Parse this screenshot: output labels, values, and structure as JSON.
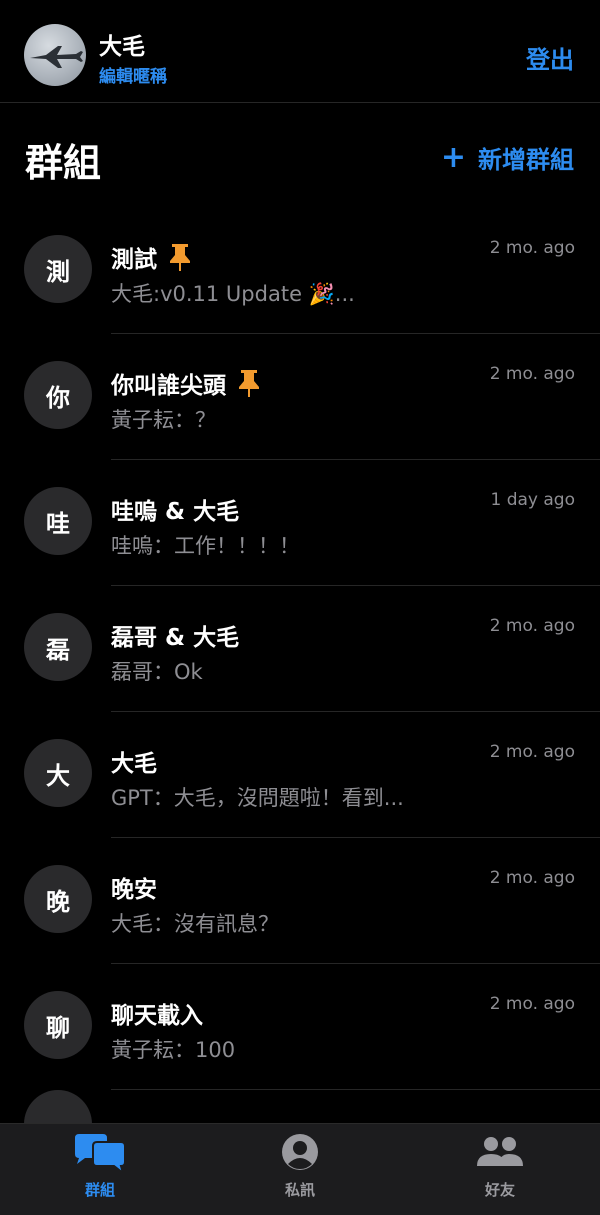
{
  "profile": {
    "name": "大毛",
    "edit_label": "編輯暱稱",
    "logout_label": "登出"
  },
  "section": {
    "title": "群組",
    "add_label": "新增群組",
    "add_icon": "plus-icon"
  },
  "colors": {
    "accent": "#2d8cf0",
    "pin": "#f29a2e",
    "muted": "#8e8e93",
    "avatar_bg": "#2a2a2c"
  },
  "chats": [
    {
      "avatar": "測",
      "name": "測試",
      "pinned": true,
      "preview": "大毛:v0.11 Update 🎉...",
      "time": "2 mo. ago"
    },
    {
      "avatar": "你",
      "name": "你叫誰尖頭",
      "pinned": true,
      "preview": "黃子耘：？",
      "time": "2 mo. ago"
    },
    {
      "avatar": "哇",
      "name": "哇嗚 & 大毛",
      "pinned": false,
      "preview": "哇嗚：工作！！！！",
      "time": "1 day ago"
    },
    {
      "avatar": "磊",
      "name": "磊哥 & 大毛",
      "pinned": false,
      "preview": "磊哥：Ok",
      "time": "2 mo. ago"
    },
    {
      "avatar": "大",
      "name": "大毛",
      "pinned": false,
      "preview": "GPT：大毛，沒問題啦！看到...",
      "time": "2 mo. ago"
    },
    {
      "avatar": "晚",
      "name": "晚安",
      "pinned": false,
      "preview": "大毛：沒有訊息？",
      "time": "2 mo. ago"
    },
    {
      "avatar": "聊",
      "name": "聊天載入",
      "pinned": false,
      "preview": "黃子耘：100",
      "time": "2 mo. ago"
    }
  ],
  "tabs": [
    {
      "label": "群組",
      "icon": "chat-bubbles-icon",
      "active": true
    },
    {
      "label": "私訊",
      "icon": "person-circle-icon",
      "active": false
    },
    {
      "label": "好友",
      "icon": "people-icon",
      "active": false
    }
  ]
}
